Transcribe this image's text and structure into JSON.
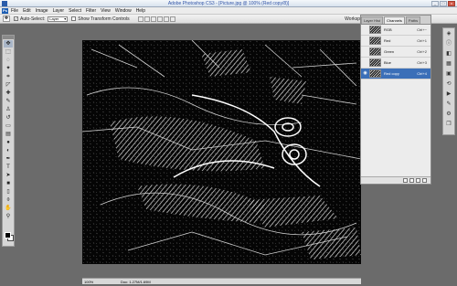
{
  "window": {
    "title": "Adobe Photoshop CS3 - [Picture.jpg @ 100% (Red copy/8)]",
    "buttons": [
      "_",
      "□",
      "x"
    ]
  },
  "menu": {
    "logo": "Ps",
    "items": [
      "File",
      "Edit",
      "Image",
      "Layer",
      "Select",
      "Filter",
      "View",
      "Window",
      "Help"
    ]
  },
  "options": {
    "auto_select_label": "Auto-Select:",
    "auto_select_value": "Layer",
    "show_transform_label": "Show Transform Controls",
    "workspace_label": "Workspace ▾"
  },
  "panel": {
    "tabs": [
      "Layer Hist",
      "Channels",
      "Paths"
    ],
    "channels": [
      {
        "name": "RGB",
        "shortcut": "Ctrl+~",
        "visible": false,
        "selected": false
      },
      {
        "name": "Red",
        "shortcut": "Ctrl+1",
        "visible": false,
        "selected": false
      },
      {
        "name": "Green",
        "shortcut": "Ctrl+2",
        "visible": false,
        "selected": false
      },
      {
        "name": "Blue",
        "shortcut": "Ctrl+3",
        "visible": false,
        "selected": false
      },
      {
        "name": "Red copy",
        "shortcut": "Ctrl+4",
        "visible": true,
        "selected": true
      }
    ]
  },
  "status": {
    "zoom": "100%",
    "doc": "Doc: 1.27M/1.69M"
  },
  "colors": {
    "selection": "#3b6fb8",
    "title_text": "#3356a8",
    "foreground": "#000000",
    "background": "#ffffff"
  }
}
